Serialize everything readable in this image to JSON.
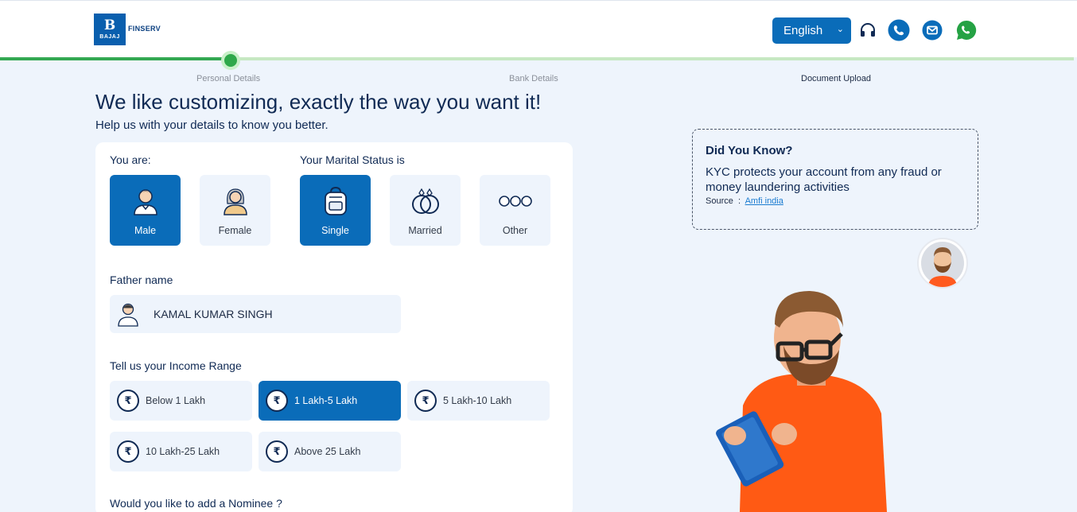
{
  "header": {
    "logo": {
      "mark": "B",
      "word": "BAJAJ",
      "suffix": "FINSERV"
    },
    "language": "English",
    "icons": [
      "headphones-icon",
      "phone-icon",
      "mail-icon",
      "whatsapp-icon"
    ]
  },
  "progress": {
    "steps": [
      "Personal Details",
      "Bank Details",
      "Document Upload"
    ],
    "active_step_index": 0
  },
  "page": {
    "title": "We like customizing, exactly the way you want it!",
    "subtitle": "Help us with your details to know you better."
  },
  "form": {
    "gender": {
      "label": "You are:",
      "options": [
        "Male",
        "Female"
      ],
      "selected": "Male"
    },
    "marital": {
      "label": "Your Marital Status is",
      "options": [
        "Single",
        "Married",
        "Other"
      ],
      "selected": "Single"
    },
    "father": {
      "label": "Father name",
      "value": "KAMAL KUMAR SINGH"
    },
    "income": {
      "label": "Tell us your Income Range",
      "options": [
        "Below 1 Lakh",
        "1 Lakh-5 Lakh",
        "5 Lakh-10 Lakh",
        "10 Lakh-25 Lakh",
        "Above 25 Lakh"
      ],
      "selected": "1 Lakh-5 Lakh"
    },
    "nominee": {
      "label": "Would you like to add a Nominee ?"
    }
  },
  "tip": {
    "title": "Did You Know?",
    "body": "KYC protects your account from any fraud or money laundering activities",
    "source_label": "Source",
    "source_sep": ":",
    "source_link": "Amfi india"
  },
  "colors": {
    "brand_blue": "#0a6cb9",
    "progress_green": "#33a852",
    "page_bg": "#eef4fc",
    "whatsapp": "#25a244"
  }
}
